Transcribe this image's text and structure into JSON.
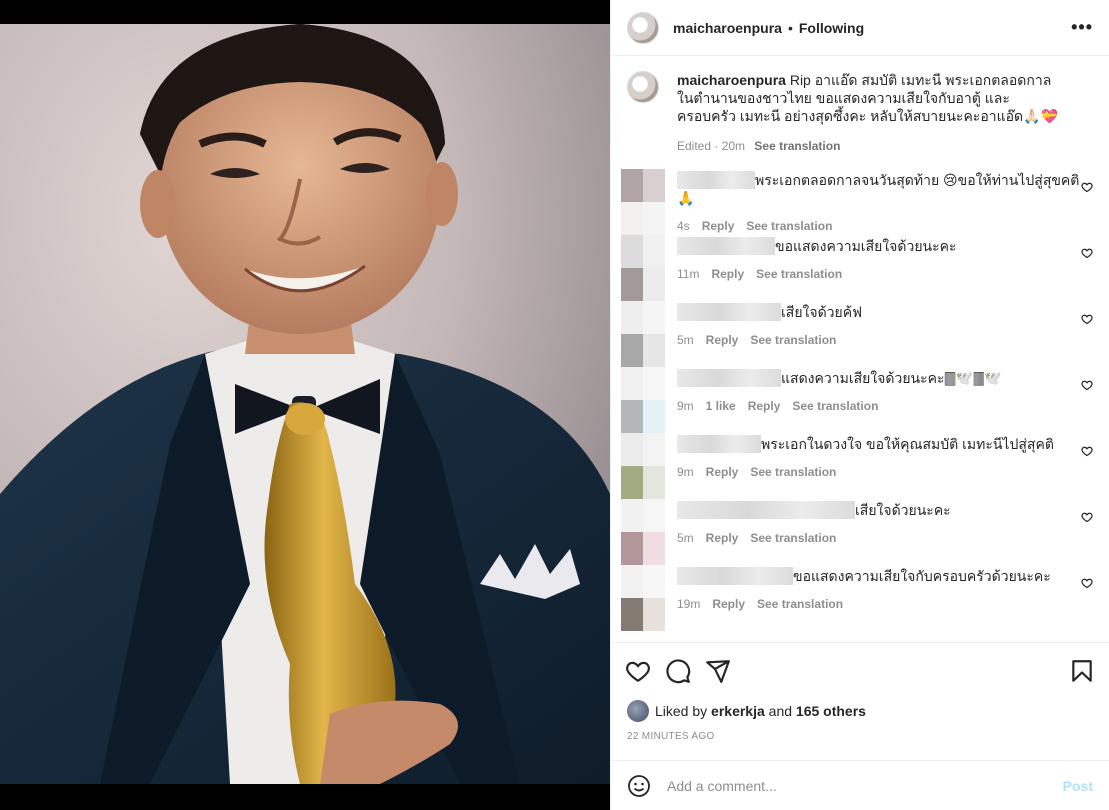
{
  "header": {
    "username": "maicharoenpura",
    "separator": "•",
    "follow_status": "Following",
    "more_label": "•••"
  },
  "caption": {
    "username": "maicharoenpura",
    "text": "Rip อาแอ๊ด สมบัติ เมทะนี พระเอกตลอดกาล ในตำนานของชาวไทย ขอแสดงความเสียใจกับอาตู้ และครอบครัว เมทะนี อย่างสุดซึ้งคะ หลับให้สบายนะคะอาแอ๊ด🙏🏻💝",
    "edited": "Edited · 20m",
    "see_translation": "See translation"
  },
  "comments": [
    {
      "text": "พระเอกตลอดกาลจนวันสุดท้าย 😢ขอให้ท่านไปสู่สุขคติ 🙏",
      "time": "4s",
      "likes": "",
      "reply": "Reply",
      "translate": "See translation",
      "blur_w": 78,
      "av": [
        "#b0a4a4",
        "#d8d0d0",
        "#f2efef",
        "#f4f4f4"
      ]
    },
    {
      "text": "ขอแสดงความเสียใจด้วยนะคะ",
      "time": "11m",
      "likes": "",
      "reply": "Reply",
      "translate": "See translation",
      "blur_w": 98,
      "av": [
        "#dcdcdc",
        "#f0f0f0",
        "#a39998",
        "#ececec"
      ]
    },
    {
      "text": "เสียใจด้วยค้ฟ",
      "time": "5m",
      "likes": "",
      "reply": "Reply",
      "translate": "See translation",
      "blur_w": 104,
      "av": [
        "#eeeeee",
        "#f5f5f5",
        "#a8a8a8",
        "#e6e6e6"
      ]
    },
    {
      "text": "แสดงความเสียใจด้วยนะคะ🀫🕊️🀫🕊️",
      "time": "9m",
      "likes": "1 like",
      "reply": "Reply",
      "translate": "See translation",
      "blur_w": 104,
      "av": [
        "#f0f0f0",
        "#f6f6f6",
        "#b3b7b8",
        "#e4f1f8"
      ]
    },
    {
      "text": "พระเอกในดวงใจ ขอให้คุณสมบัติ เมทะนีไปสู่สุคติ",
      "time": "9m",
      "likes": "",
      "reply": "Reply",
      "translate": "See translation",
      "blur_w": 84,
      "av": [
        "#ececec",
        "#f3f3f3",
        "#a3ab82",
        "#e3e6dc"
      ]
    },
    {
      "text": "เสียใจด้วยนะคะ",
      "time": "5m",
      "likes": "",
      "reply": "Reply",
      "translate": "See translation",
      "blur_w": 178,
      "av": [
        "#f1f1f1",
        "#f6f6f6",
        "#b3969a",
        "#efdde3"
      ]
    },
    {
      "text": "ขอแสดงความเสียใจกับครอบครัวด้วยนะคะ",
      "time": "19m",
      "likes": "",
      "reply": "Reply",
      "translate": "See translation",
      "blur_w": 116,
      "av": [
        "#f2f2f2",
        "#f7f7f7",
        "#857b73",
        "#e6e1dd"
      ]
    }
  ],
  "likes": {
    "prefix": "Liked by",
    "user": "erkerkja",
    "and": "and",
    "others": "165 others"
  },
  "timestamp": "22 MINUTES AGO",
  "add_comment": {
    "placeholder": "Add a comment...",
    "post_label": "Post"
  },
  "icons": [
    "heart-icon",
    "comment-icon",
    "share-icon",
    "bookmark-icon",
    "emoji-icon",
    "more-icon"
  ],
  "colors": {
    "post_disabled": "#b2dffc",
    "muted": "#8e8e8e",
    "text": "#262626"
  }
}
